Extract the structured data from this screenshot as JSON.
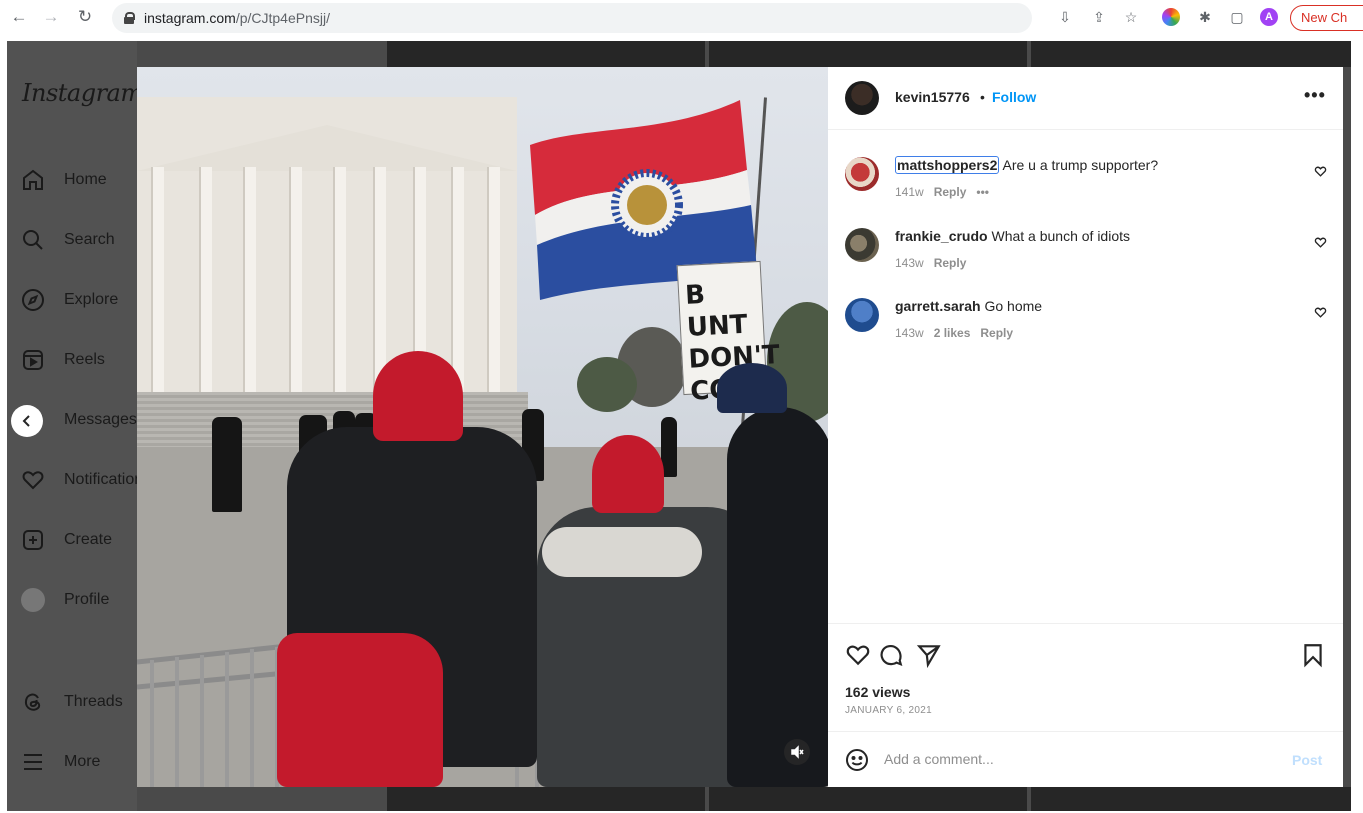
{
  "browser": {
    "back_icon": "arrow-left-icon",
    "forward_icon": "arrow-right-icon",
    "reload_icon": "reload-icon",
    "url_domain": "instagram.com",
    "url_path": "/p/CJtp4ePnsjj/",
    "new_chrome_label": "New Ch"
  },
  "sidebar": {
    "logo": "Instagram",
    "items": [
      {
        "label": "Home",
        "icon": "home-icon"
      },
      {
        "label": "Search",
        "icon": "search-icon"
      },
      {
        "label": "Explore",
        "icon": "compass-icon"
      },
      {
        "label": "Reels",
        "icon": "reels-icon"
      },
      {
        "label": "Messages",
        "icon": "messenger-icon"
      },
      {
        "label": "Notifications",
        "icon": "heart-icon"
      },
      {
        "label": "Create",
        "icon": "plus-square-icon"
      },
      {
        "label": "Profile",
        "icon": "profile-avatar"
      },
      {
        "label": "Threads",
        "icon": "threads-icon"
      },
      {
        "label": "More",
        "icon": "hamburger-icon"
      }
    ]
  },
  "post": {
    "author": "kevin15776",
    "separator": "•",
    "follow_label": "Follow",
    "more_label": "•••",
    "comments": [
      {
        "username": "mattshoppers2",
        "text": "Are u a trump supporter?",
        "age": "141w",
        "likes": "",
        "reply_label": "Reply",
        "more": "•••"
      },
      {
        "username": "frankie_crudo",
        "text": "What a bunch of idiots",
        "age": "143w",
        "likes": "",
        "reply_label": "Reply",
        "more": ""
      },
      {
        "username": "garrett.sarah",
        "text": "Go home",
        "age": "143w",
        "likes": "2 likes",
        "reply_label": "Reply",
        "more": ""
      }
    ],
    "views": "162 views",
    "date": "JANUARY 6, 2021",
    "add_comment_placeholder": "Add a comment...",
    "post_label": "Post"
  },
  "media": {
    "sign_text": "B UNT\nDON'T\nCOME"
  },
  "colors": {
    "accent": "#0095f6",
    "post_disabled": "#c0dffd",
    "hat_red": "#c31a2c"
  }
}
